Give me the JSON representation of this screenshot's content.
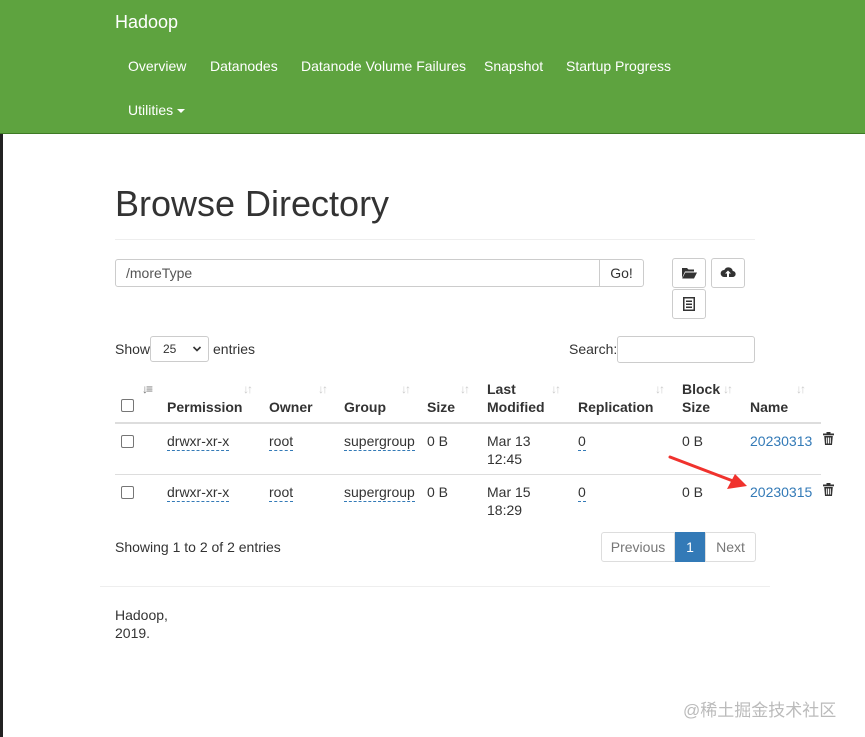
{
  "navbar": {
    "brand": "Hadoop",
    "items": [
      "Overview",
      "Datanodes",
      "Datanode Volume Failures",
      "Snapshot",
      "Startup Progress"
    ],
    "utilities": "Utilities",
    "color": "#5ea33f"
  },
  "page": {
    "title": "Browse Directory"
  },
  "pathbar": {
    "value": "/moreType",
    "go_label": "Go!"
  },
  "toolbar": {
    "icons": [
      "folder-open-icon",
      "cloud-upload-icon",
      "list-icon"
    ]
  },
  "table_controls": {
    "show_label": "Show",
    "page_length": "25",
    "entries_label": "entries",
    "search_label": "Search:"
  },
  "table": {
    "headers": [
      "Permission",
      "Owner",
      "Group",
      "Size",
      "Last",
      "Modified",
      "Replication",
      "Block",
      "Size",
      "Name"
    ],
    "rows": [
      {
        "permission": "drwxr-xr-x",
        "owner": "root",
        "group": "supergroup",
        "size": "0 B",
        "date": "Mar 13",
        "time": "12:45",
        "replication": "0",
        "block_size": "0 B",
        "name": "20230313"
      },
      {
        "permission": "drwxr-xr-x",
        "owner": "root",
        "group": "supergroup",
        "size": "0 B",
        "date": "Mar 15",
        "time": "18:29",
        "replication": "0",
        "block_size": "0 B",
        "name": "20230315"
      }
    ]
  },
  "pagination": {
    "info": "Showing 1 to 2 of 2 entries",
    "previous": "Previous",
    "current": "1",
    "next": "Next",
    "active_color": "#337ab7"
  },
  "footer": {
    "line1": "Hadoop,",
    "line2": "2019."
  },
  "annotation": {
    "color": "#f0322d"
  },
  "watermark": "@稀土掘金技术社区"
}
